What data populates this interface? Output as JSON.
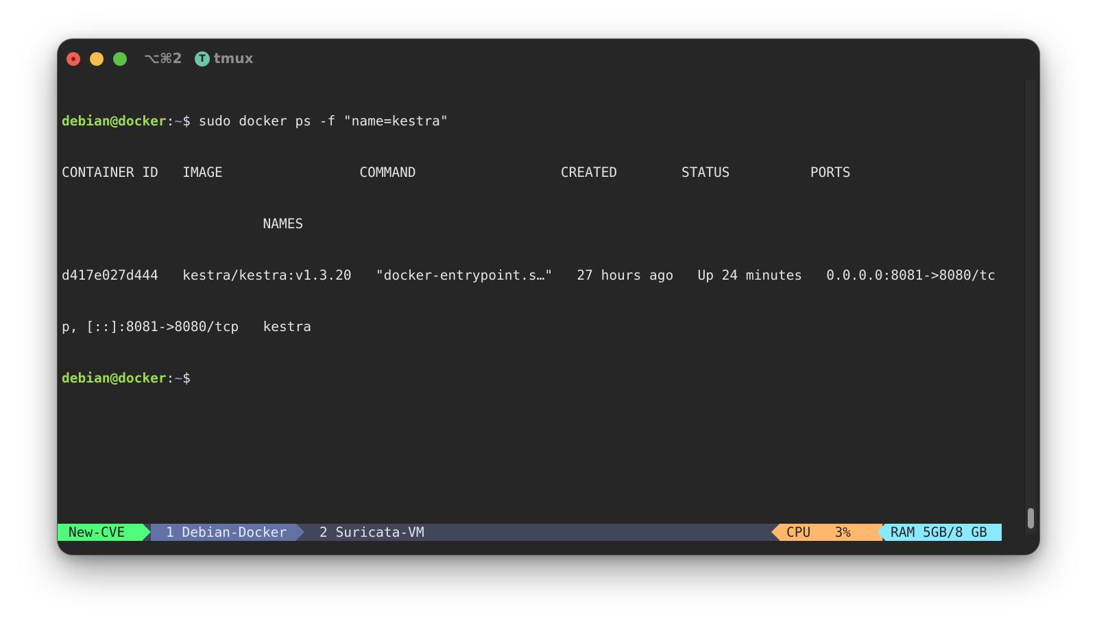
{
  "titlebar": {
    "shortcut": "⌥⌘2",
    "app_icon_letter": "T",
    "app_name": "tmux"
  },
  "terminal": {
    "prompt_user_host": "debian@docker",
    "prompt_colon": ":",
    "prompt_path": "~",
    "prompt_symbol": "$",
    "command": " sudo docker ps -f \"name=kestra\"",
    "output_lines": [
      "CONTAINER ID   IMAGE                 COMMAND                  CREATED        STATUS          PORTS",
      "                         NAMES",
      "d417e027d444   kestra/kestra:v1.3.20   \"docker-entrypoint.s…\"   27 hours ago   Up 24 minutes   0.0.0.0:8081->8080/tc",
      "p, [::]:8081->8080/tcp   kestra"
    ]
  },
  "statusbar": {
    "session_name": "New-CVE",
    "window_1": "1 Debian-Docker",
    "window_2": "2 Suricata-VM",
    "cpu": "CPU   3%",
    "ram": "RAM 5GB/8 GB"
  },
  "colors": {
    "window_bg": "#262626",
    "prompt_user": "#9cdb58",
    "prompt_path": "#7aa6da",
    "status_bg": "#41465a",
    "session_bg": "#50fa7b",
    "window1_bg": "#6272a4",
    "cpu_bg": "#ffb86c",
    "ram_bg": "#8be9fd"
  }
}
